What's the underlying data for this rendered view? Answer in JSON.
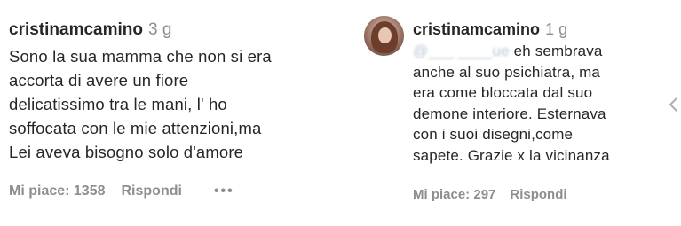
{
  "comments": [
    {
      "username": "cristinamcamino",
      "time": "3 g",
      "lines": [
        "Sono la sua mamma che non si era",
        "accorta di avere un fiore",
        "delicatissimo tra le mani, l' ho",
        "soffocata con le mie attenzioni,ma",
        "Lei aveva bisogno solo d'amore"
      ],
      "likes": "Mi piace: 1358",
      "reply": "Rispondi",
      "more": "•••"
    },
    {
      "username": "cristinamcamino",
      "time": "1 g",
      "mention": "@___ ____ue",
      "first_line_rest": " eh sembrava",
      "lines": [
        "anche al suo psichiatra, ma",
        "era come bloccata dal suo",
        "demone interiore. Esternava",
        "con i suoi disegni,come",
        "sapete. Grazie x la vicinanza"
      ],
      "likes": "Mi piace: 297",
      "reply": "Rispondi"
    }
  ],
  "icons": {
    "avatar": "profile-photo",
    "scroll": "chevron-left-icon"
  }
}
